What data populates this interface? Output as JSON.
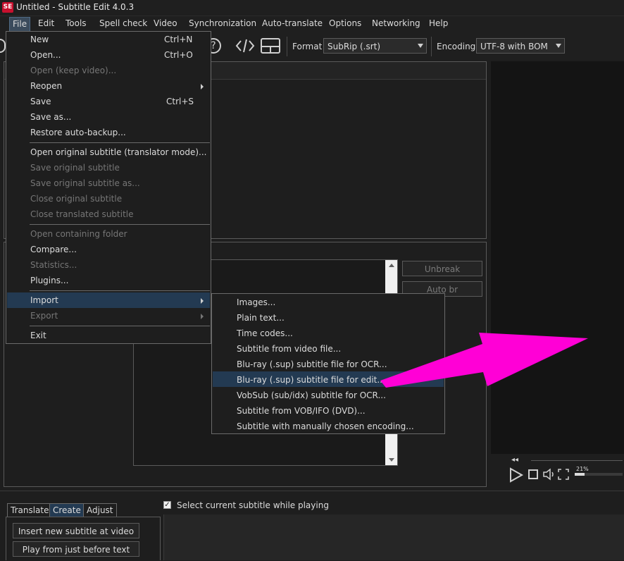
{
  "window": {
    "title": "Untitled - Subtitle Edit 4.0.3",
    "app_icon_text": "SE"
  },
  "menubar": [
    "File",
    "Edit",
    "Tools",
    "Spell check",
    "Video",
    "Synchronization",
    "Auto-translate",
    "Options",
    "Networking",
    "Help"
  ],
  "toolbar": {
    "format_label": "Format",
    "format_value": "SubRip (.srt)",
    "encoding_label": "Encoding",
    "encoding_value": "UTF-8 with BOM"
  },
  "file_menu": {
    "new": "New",
    "new_sc": "Ctrl+N",
    "open": "Open...",
    "open_sc": "Ctrl+O",
    "open_keep_video": "Open (keep video)...",
    "reopen": "Reopen",
    "save": "Save",
    "save_sc": "Ctrl+S",
    "save_as": "Save as...",
    "restore_backup": "Restore auto-backup...",
    "open_original": "Open original subtitle (translator mode)...",
    "save_original": "Save original subtitle",
    "save_original_as": "Save original subtitle as...",
    "close_original": "Close original subtitle",
    "close_translated": "Close translated subtitle",
    "open_folder": "Open containing folder",
    "compare": "Compare...",
    "statistics": "Statistics...",
    "plugins": "Plugins...",
    "import": "Import",
    "export": "Export",
    "exit": "Exit"
  },
  "import_menu": [
    "Images...",
    "Plain text...",
    "Time codes...",
    "Subtitle from video file...",
    "Blu-ray (.sup) subtitle file for OCR...",
    "Blu-ray (.sup) subtitle file for edit...",
    "VobSub (sub/idx) subtitle for OCR...",
    "Subtitle from VOB/IFO (DVD)...",
    "Subtitle with manually chosen encoding..."
  ],
  "editor": {
    "unbreak": "Unbreak",
    "auto_br": "Auto br"
  },
  "tabs": [
    "Translate",
    "Create",
    "Adjust"
  ],
  "checkbox_label": "Select current subtitle while playing",
  "create_buttons": [
    "Insert new subtitle at video pos",
    "Play from just before text"
  ],
  "video": {
    "volume": "21%"
  },
  "colors": {
    "arrow": "#ff00d6",
    "highlight": "#233a52"
  }
}
